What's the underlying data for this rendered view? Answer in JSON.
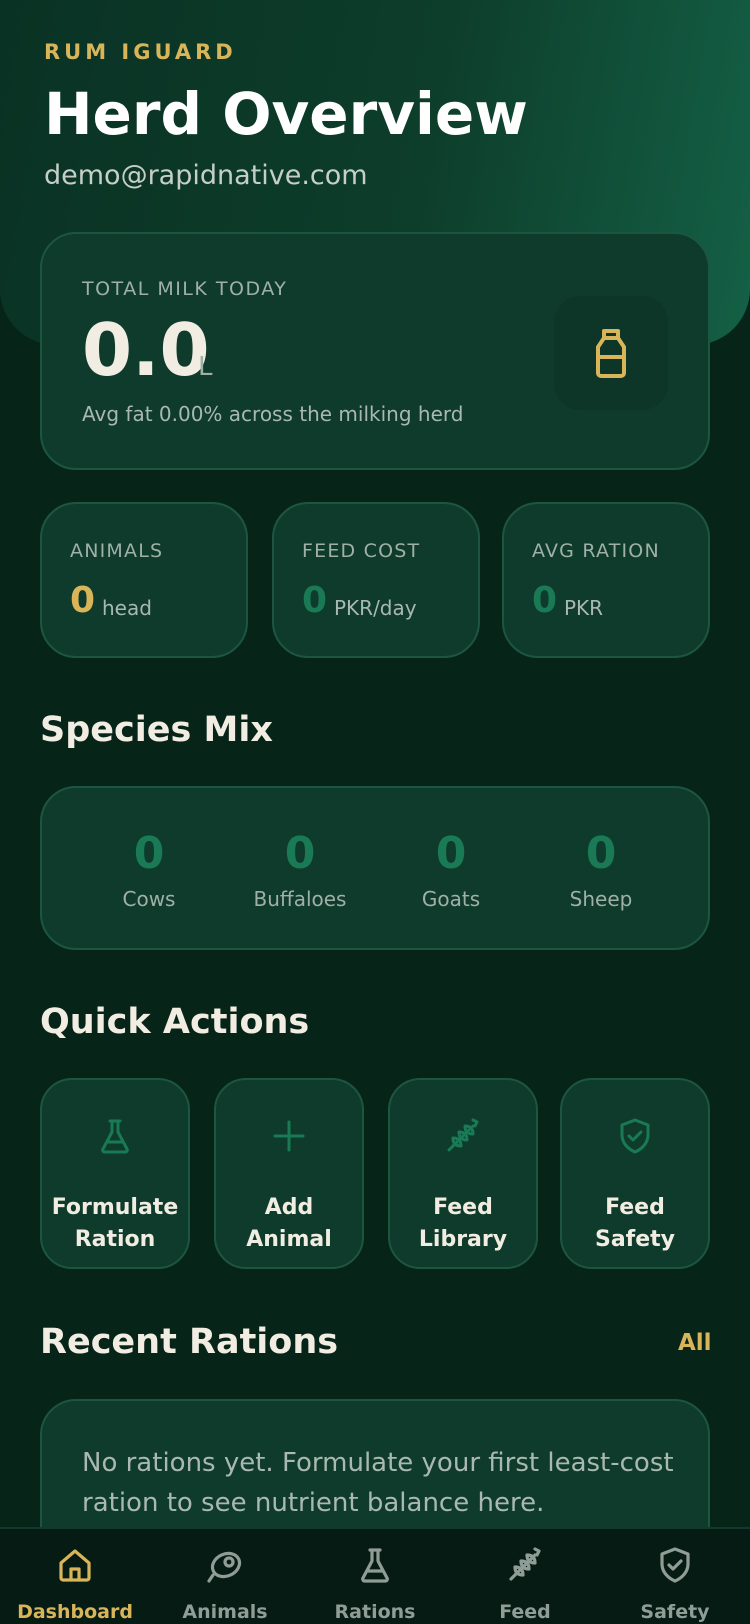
{
  "header": {
    "brand": "RUM IGUARD",
    "title": "Herd Overview",
    "email": "demo@rapidnative.com"
  },
  "milk": {
    "label": "TOTAL MILK TODAY",
    "value": "0.0",
    "unit": "L",
    "subtitle": "Avg fat 0.00% across the milking herd",
    "icon": "milk-bottle-icon"
  },
  "stats": [
    {
      "label": "ANIMALS",
      "value": "0",
      "unit": "head",
      "color": "#d9b55a"
    },
    {
      "label": "FEED COST",
      "value": "0",
      "unit": "PKR/day",
      "color": "#197a55"
    },
    {
      "label": "AVG RATION",
      "value": "0",
      "unit": "PKR",
      "color": "#197a55"
    }
  ],
  "species": {
    "title": "Species Mix",
    "items": [
      {
        "label": "Cows",
        "count": "0"
      },
      {
        "label": "Buffaloes",
        "count": "0"
      },
      {
        "label": "Goats",
        "count": "0"
      },
      {
        "label": "Sheep",
        "count": "0"
      }
    ]
  },
  "quick_actions": {
    "title": "Quick Actions",
    "items": [
      {
        "line1": "Formulate",
        "line2": "Ration",
        "icon": "flask-icon"
      },
      {
        "line1": "Add",
        "line2": "Animal",
        "icon": "plus-icon"
      },
      {
        "line1": "Feed",
        "line2": "Library",
        "icon": "wheat-icon"
      },
      {
        "line1": "Feed",
        "line2": "Safety",
        "icon": "shield-check-icon"
      }
    ]
  },
  "recent_rations": {
    "title": "Recent Rations",
    "see_all": "All",
    "empty_text": "No rations yet. Formulate your first least-cost ration to see nutrient balance here."
  },
  "tabs": [
    {
      "label": "Dashboard",
      "icon": "home-icon",
      "active": true
    },
    {
      "label": "Animals",
      "icon": "animal-tag-icon",
      "active": false
    },
    {
      "label": "Rations",
      "icon": "flask-icon",
      "active": false
    },
    {
      "label": "Feed",
      "icon": "wheat-icon",
      "active": false
    },
    {
      "label": "Safety",
      "icon": "shield-check-icon",
      "active": false
    }
  ],
  "colors": {
    "background": "#072419",
    "card": "#0f3b2d",
    "accent_gold": "#d9b55a",
    "accent_green": "#197a55"
  }
}
